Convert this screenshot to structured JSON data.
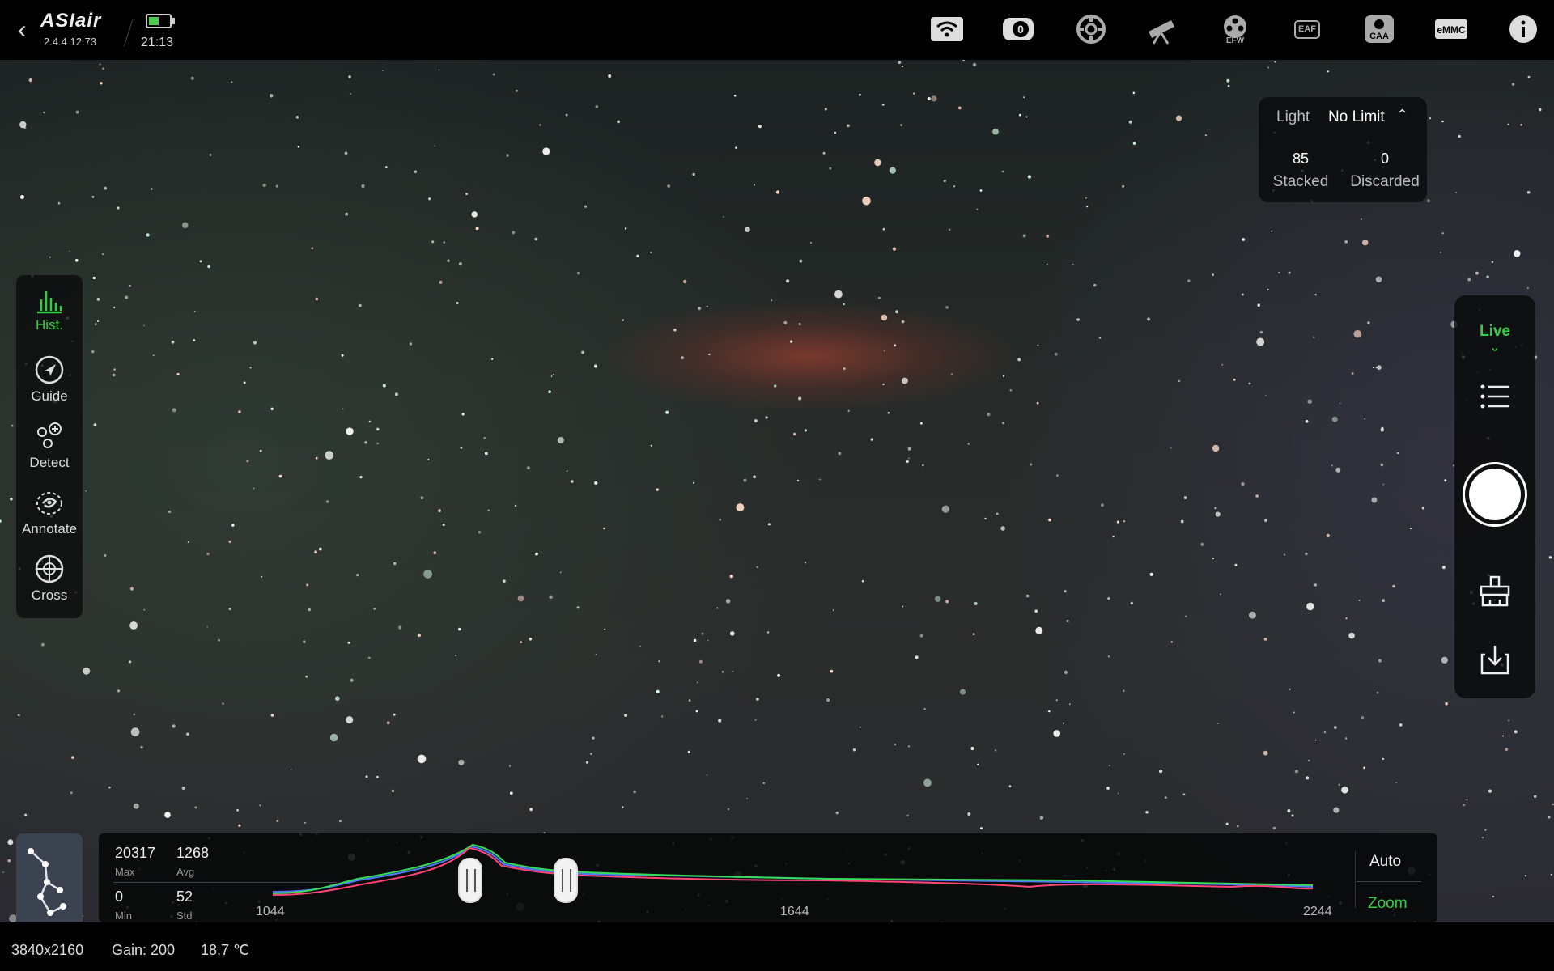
{
  "app": {
    "name": "ASIair",
    "version": "2.4.4 12.73",
    "time": "21:13",
    "battery_level": 0.5
  },
  "top_icons": [
    "wifi-icon",
    "camera-icon",
    "focuser-target-icon",
    "telescope-icon",
    "efw-icon",
    "eaf-icon",
    "caa-icon",
    "emmc-icon",
    "info-icon"
  ],
  "top_labels": {
    "efw": "EFW",
    "eaf": "EAF",
    "caa": "CAA",
    "emmc": "eMMC"
  },
  "tools": [
    {
      "label": "Hist.",
      "icon": "histogram-icon",
      "active": true
    },
    {
      "label": "Guide",
      "icon": "guide-icon",
      "active": false
    },
    {
      "label": "Detect",
      "icon": "detect-stars-icon",
      "active": false
    },
    {
      "label": "Annotate",
      "icon": "annotate-icon",
      "active": false
    },
    {
      "label": "Cross",
      "icon": "crosshair-icon",
      "active": false
    }
  ],
  "stack": {
    "type_label": "Light",
    "limit": "No Limit",
    "stacked": "85",
    "stacked_label": "Stacked",
    "discarded": "0",
    "discarded_label": "Discarded"
  },
  "right_panel": {
    "mode": "Live"
  },
  "histogram": {
    "max": "20317",
    "max_label": "Max",
    "avg": "1268",
    "avg_label": "Avg",
    "min": "0",
    "min_label": "Min",
    "std": "52",
    "std_label": "Std",
    "ticks": [
      "1044",
      "1644",
      "2244"
    ],
    "auto_label": "Auto",
    "zoom_label": "Zoom",
    "x_range": [
      1044,
      2244
    ],
    "black_point": 1270,
    "white_point": 1380
  },
  "status": {
    "resolution": "3840x2160",
    "gain": "Gain: 200",
    "temperature": "18,7 ℃"
  },
  "colors": {
    "accent": "#33cc44",
    "nebula": "#b84a38"
  }
}
